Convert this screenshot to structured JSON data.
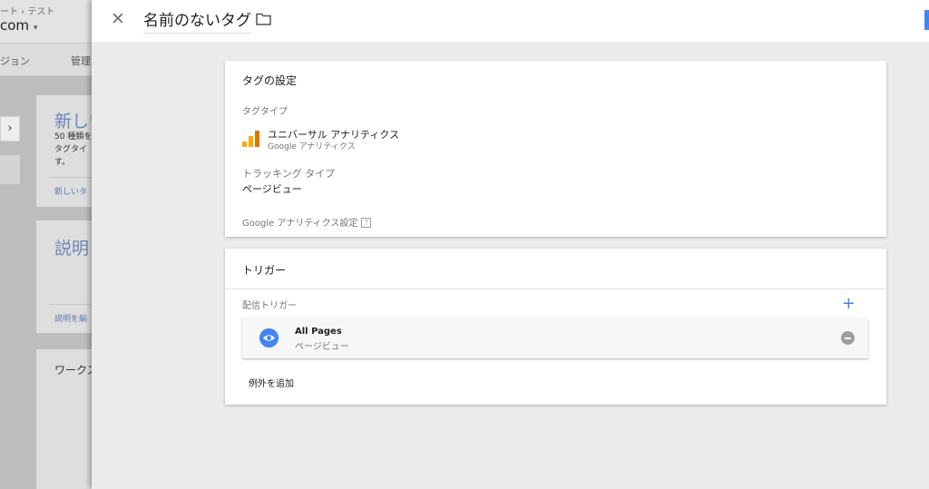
{
  "background": {
    "breadcrumb": "ート › テスト",
    "account": "com",
    "nav": [
      "ジョン",
      "管理"
    ],
    "cards": [
      {
        "title": "新しい",
        "text_lines": [
          "50 種類を",
          "タグタイ",
          "す。"
        ],
        "link": "新しいタ"
      },
      {
        "title": "説明",
        "link": "説明を編"
      },
      {
        "title": "ワークス"
      }
    ]
  },
  "header": {
    "tag_name": "名前のないタグ",
    "icons": {
      "close": "close-icon",
      "folder": "folder-icon"
    },
    "accent_color": "#4285f4"
  },
  "tag_config": {
    "title": "タグの設定",
    "tag_type_label": "タグタイプ",
    "tag_type_name": "ユニバーサル アナリティクス",
    "tag_type_sub": "Google アナリティクス",
    "tracking_type_label": "トラッキング タイプ",
    "tracking_type_value": "ページビュー",
    "ga_settings_label": "Google アナリティクス設定",
    "help_glyph": "?"
  },
  "triggers": {
    "title": "トリガー",
    "firing_label": "配信トリガー",
    "add_glyph": "+",
    "items": [
      {
        "name": "All Pages",
        "type": "ページビュー",
        "icon": "eye-icon"
      }
    ],
    "add_exception": "例外を追加"
  }
}
